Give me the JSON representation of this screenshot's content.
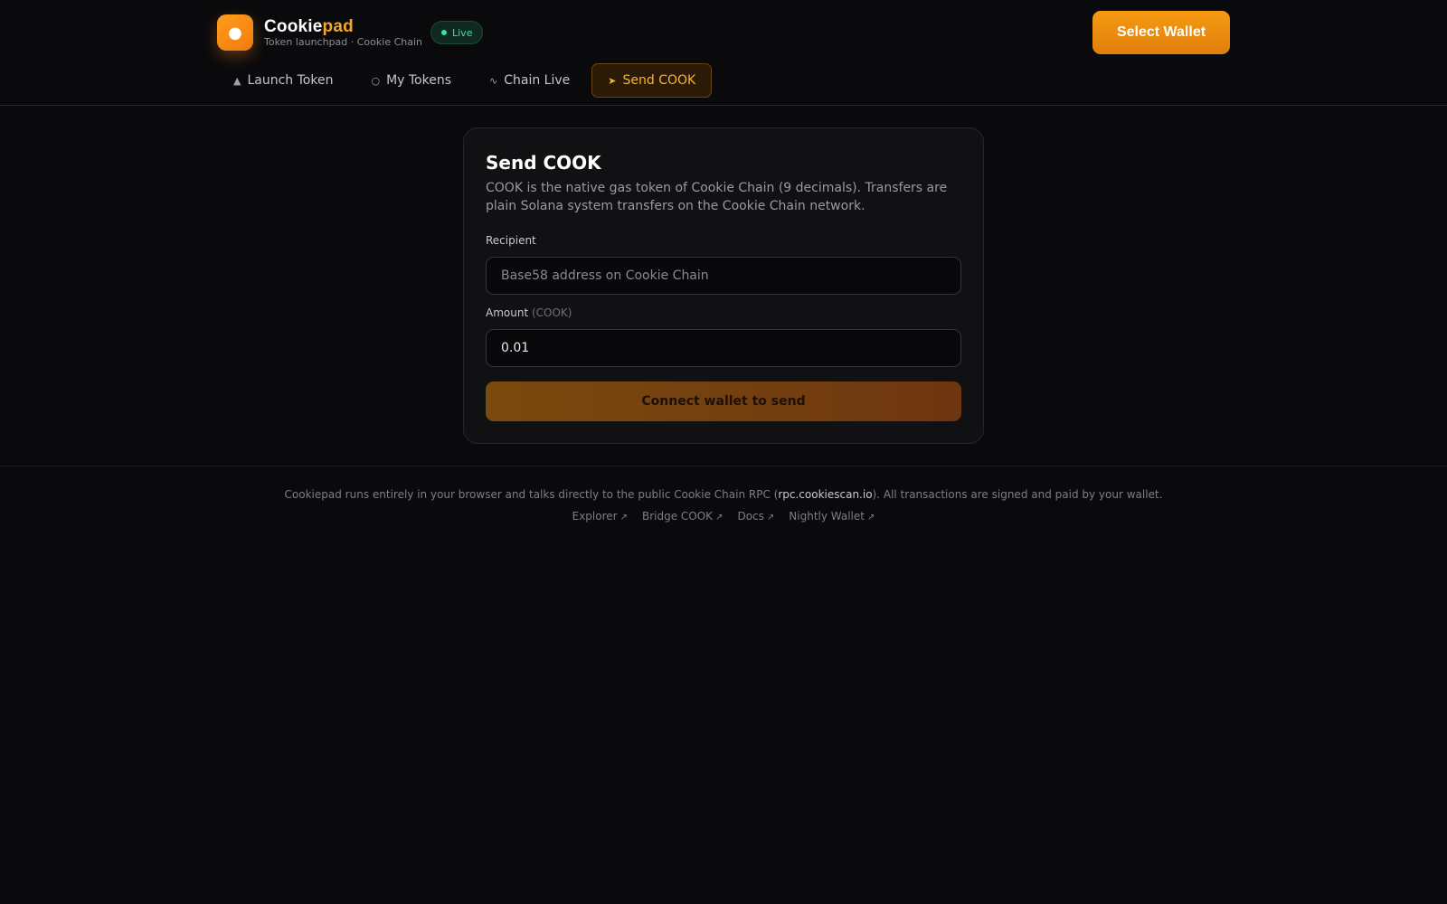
{
  "header": {
    "logo_icon": "cookie-icon",
    "brand_main": "Cookie",
    "brand_accent": "pad",
    "tagline": "Token launchpad · Cookie Chain",
    "live_label": "Live",
    "wallet_button": "Select Wallet"
  },
  "nav": {
    "tabs": [
      {
        "label": "Launch Token",
        "icon": "rocket-icon",
        "active": false
      },
      {
        "label": "My Tokens",
        "icon": "coins-icon",
        "active": false
      },
      {
        "label": "Chain Live",
        "icon": "pulse-icon",
        "active": false
      },
      {
        "label": "Send COOK",
        "icon": "send-icon",
        "active": true
      }
    ]
  },
  "send_card": {
    "title": "Send COOK",
    "description": "COOK is the native gas token of Cookie Chain (9 decimals). Transfers are plain Solana system transfers on the Cookie Chain network.",
    "recipient_label": "Recipient",
    "recipient_placeholder": "Base58 address on Cookie Chain",
    "amount_label": "Amount",
    "amount_unit": "(COOK)",
    "amount_value": "0.01",
    "submit_label": "Connect wallet to send"
  },
  "footer": {
    "text_before": "Cookiepad runs entirely in your browser and talks directly to the public Cookie Chain RPC (",
    "rpc_host": "rpc.cookiescan.io",
    "text_after": "). All transactions are signed and paid by your wallet.",
    "links": [
      {
        "label": "Explorer",
        "icon": "external-link-icon"
      },
      {
        "label": "Bridge COOK",
        "icon": "external-link-icon"
      },
      {
        "label": "Docs",
        "icon": "external-link-icon"
      },
      {
        "label": "Nightly Wallet",
        "icon": "external-link-icon"
      }
    ]
  },
  "colors": {
    "accent": "#f5a623",
    "background": "#0a0a0d",
    "live_green": "#3ee29a"
  }
}
